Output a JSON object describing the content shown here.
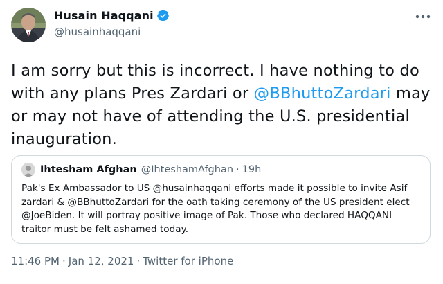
{
  "author": {
    "display_name": "Husain Haqqani",
    "handle": "@husainhaqqani",
    "verified_icon": "verified-badge-icon",
    "accent_color": "#1d9bf0"
  },
  "menu": {
    "icon": "more-dots-icon"
  },
  "tweet": {
    "text_part1": "I am sorry but this is incorrect. I have nothing to do with any plans Pres Zardari or ",
    "mention": "@BBhuttoZardari",
    "text_part2": " may or may not have of attending the U.S. presidential inauguration."
  },
  "quoted": {
    "display_name": "Ihtesham Afghan",
    "handle": "@IhteshamAfghan",
    "separator": "·",
    "time": "19h",
    "text": "Pak's Ex Ambassador to US @husainhaqqani efforts made it possible to invite Asif zardari & @BBhuttoZardari for the oath taking ceremony of the US president elect @JoeBiden. It will portray positive image of Pak. Those who declared HAQQANI traitor must be felt ashamed today."
  },
  "meta": {
    "time": "11:46 PM",
    "separator": "·",
    "date": "Jan 12, 2021",
    "source": "Twitter for iPhone"
  }
}
